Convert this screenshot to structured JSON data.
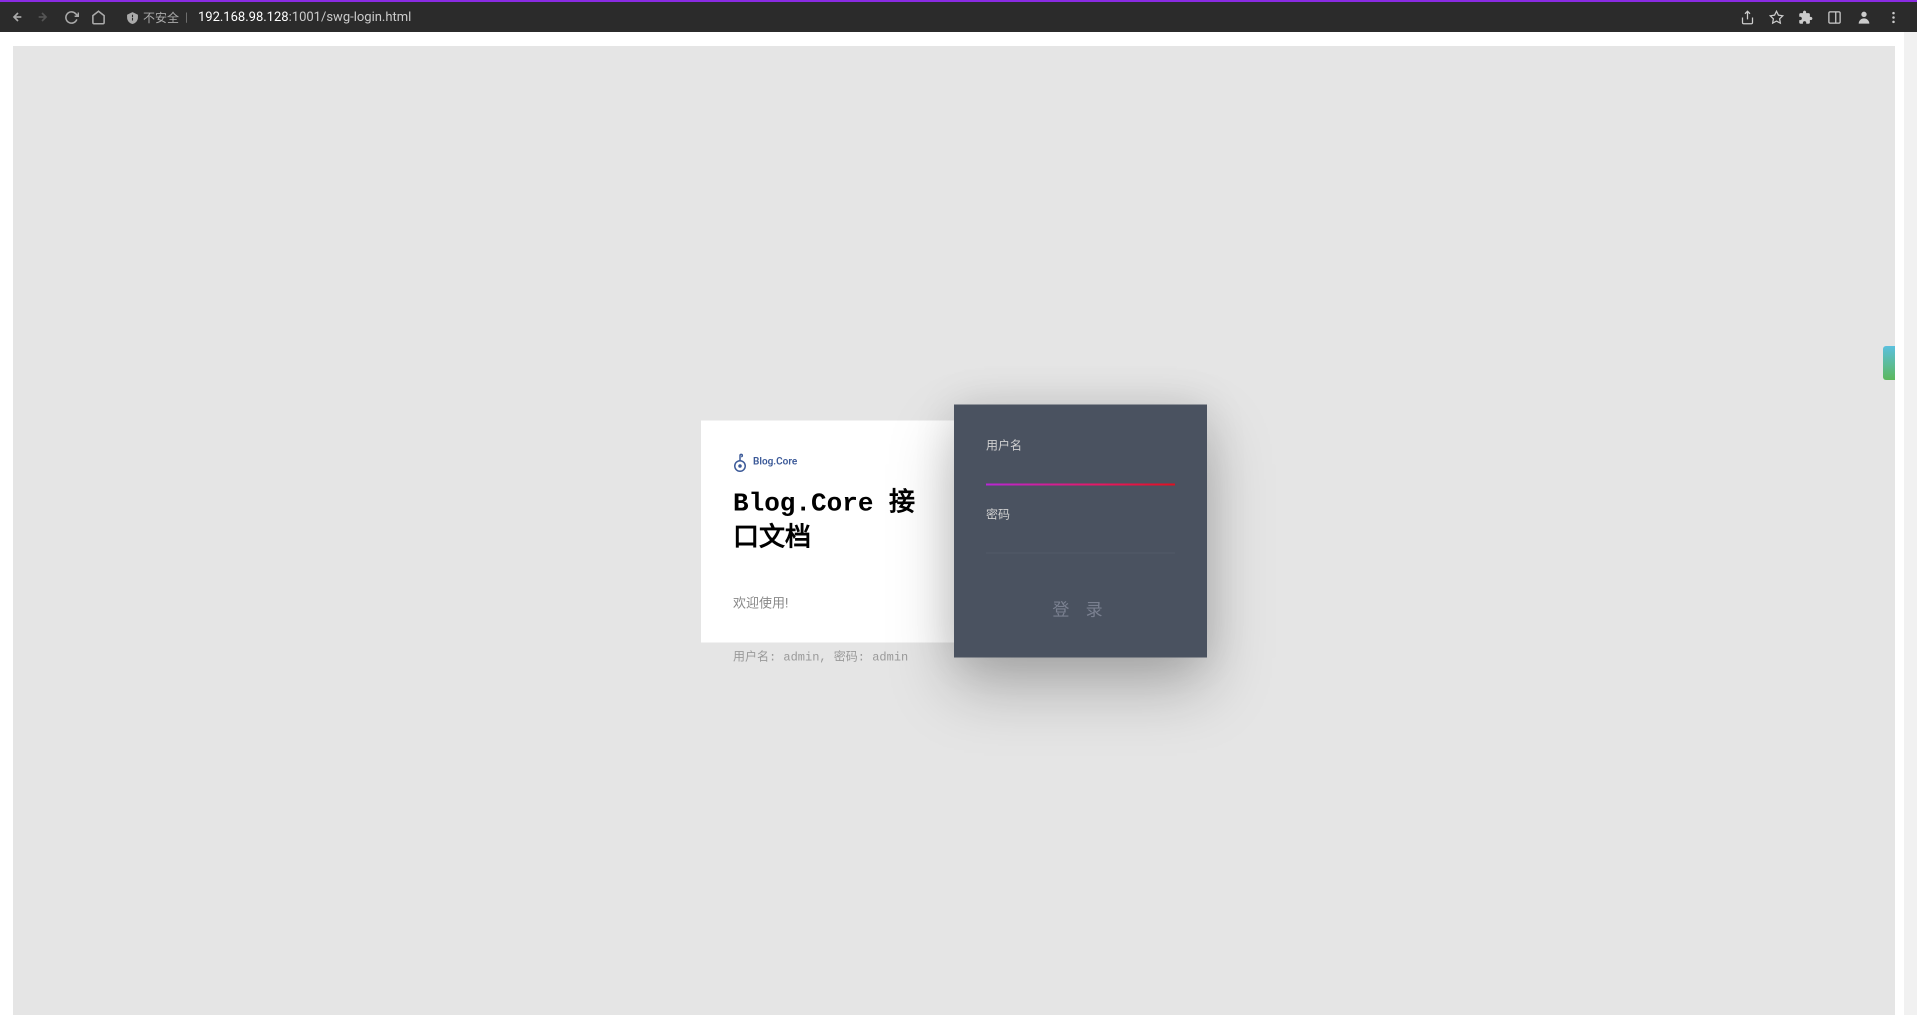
{
  "browser": {
    "security_label": "不安全",
    "url_host": "192.168.98.128",
    "url_path": ":1001/swg-login.html"
  },
  "page": {
    "brand_name": "Blog.Core",
    "title": "Blog.Core 接口文档",
    "welcome": "欢迎使用!",
    "hint": "用户名: admin, 密码: admin"
  },
  "form": {
    "username_label": "用户名",
    "username_value": "",
    "password_label": "密码",
    "password_value": "",
    "login_button": "登 录"
  }
}
